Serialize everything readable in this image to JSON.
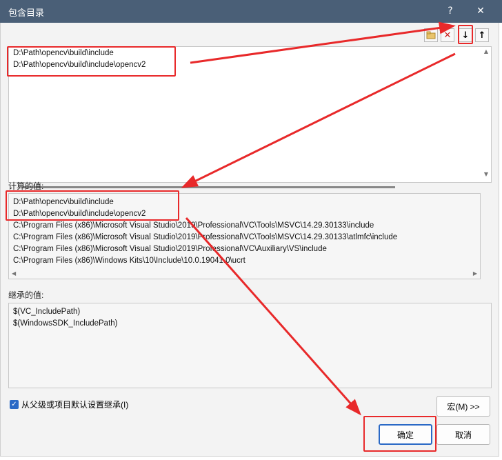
{
  "window": {
    "title": "包含目录",
    "help_label": "?",
    "close_label": "✕"
  },
  "toolbar": {
    "new_line_label": "",
    "delete_label": "✕",
    "move_down_label": "↓",
    "move_up_label": "↑"
  },
  "edit_list": {
    "lines": [
      "D:\\Path\\opencv\\build\\include",
      "D:\\Path\\opencv\\build\\include\\opencv2"
    ]
  },
  "evaluated": {
    "label": "计算的值:",
    "lines": [
      "D:\\Path\\opencv\\build\\include",
      "D:\\Path\\opencv\\build\\include\\opencv2",
      "C:\\Program Files (x86)\\Microsoft Visual Studio\\2019\\Professional\\VC\\Tools\\MSVC\\14.29.30133\\include",
      "C:\\Program Files (x86)\\Microsoft Visual Studio\\2019\\Professional\\VC\\Tools\\MSVC\\14.29.30133\\atlmfc\\include",
      "C:\\Program Files (x86)\\Microsoft Visual Studio\\2019\\Professional\\VC\\Auxiliary\\VS\\include",
      "C:\\Program Files (x86)\\Windows Kits\\10\\Include\\10.0.19041.0\\ucrt"
    ]
  },
  "inherited": {
    "label": "继承的值:",
    "lines": [
      "$(VC_IncludePath)",
      "$(WindowsSDK_IncludePath)"
    ]
  },
  "inherit_checkbox": {
    "label": "从父级或项目默认设置继承(I)",
    "checked": true
  },
  "buttons": {
    "macros_label": "宏(M) >>",
    "ok_label": "确定",
    "cancel_label": "取消"
  },
  "colors": {
    "annotation_red": "#e8292a",
    "titlebar": "#4a5f77",
    "checkbox_blue": "#2a69c6"
  }
}
